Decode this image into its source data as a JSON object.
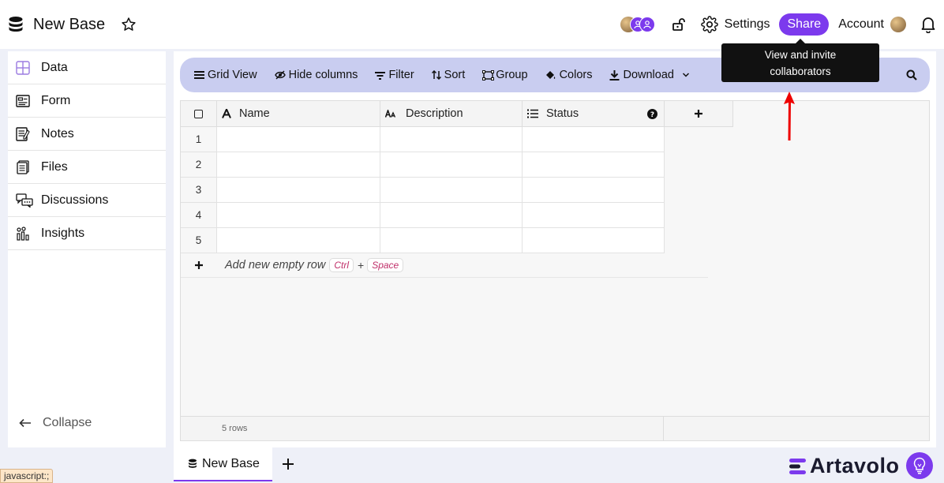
{
  "header": {
    "title": "New Base",
    "settings_label": "Settings",
    "share_label": "Share",
    "account_label": "Account"
  },
  "tooltip": {
    "line1": "View and invite",
    "line2": "collaborators"
  },
  "sidebar": {
    "items": [
      {
        "label": "Data",
        "icon": "grid-icon"
      },
      {
        "label": "Form",
        "icon": "form-icon"
      },
      {
        "label": "Notes",
        "icon": "notes-icon"
      },
      {
        "label": "Files",
        "icon": "files-icon"
      },
      {
        "label": "Discussions",
        "icon": "discussions-icon"
      },
      {
        "label": "Insights",
        "icon": "insights-icon"
      }
    ],
    "collapse_label": "Collapse"
  },
  "toolbar": {
    "grid_view": "Grid View",
    "hide_columns": "Hide columns",
    "filter": "Filter",
    "sort": "Sort",
    "group": "Group",
    "colors": "Colors",
    "download": "Download"
  },
  "table": {
    "columns": [
      "Name",
      "Description",
      "Status"
    ],
    "row_numbers": [
      "1",
      "2",
      "3",
      "4",
      "5"
    ],
    "add_row_label": "Add new empty row",
    "shortcut_key1": "Ctrl",
    "shortcut_plus": "+",
    "shortcut_key2": "Space",
    "row_count": "5 rows"
  },
  "tabs": {
    "active": "New Base"
  },
  "brand": {
    "name": "Artavolo",
    "accent": "#7c3aed"
  },
  "status_bar": "javascript:;"
}
